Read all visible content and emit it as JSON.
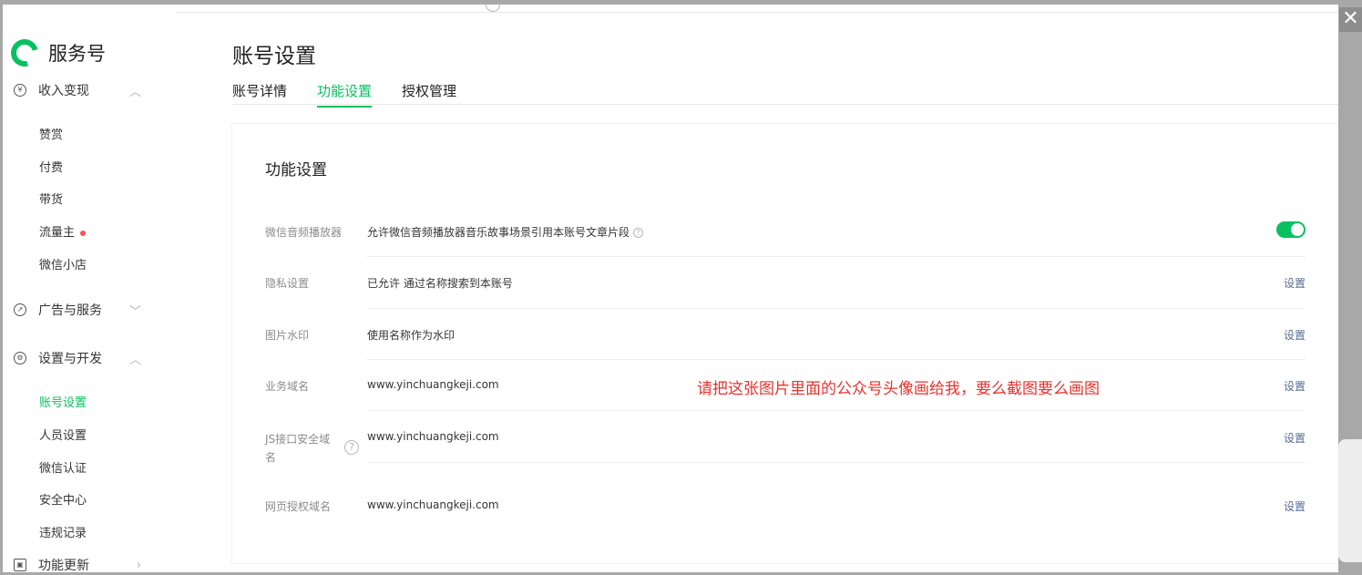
{
  "window": {
    "close_glyph": "✕"
  },
  "sidebar": {
    "brand": "服务号",
    "groups": [
      {
        "label": "收入变现",
        "icon": "yen-circle-icon",
        "chevron": "︿"
      },
      {
        "label": "广告与服务",
        "icon": "compass-icon",
        "chevron": "﹀"
      },
      {
        "label": "设置与开发",
        "icon": "gear-icon",
        "chevron": "︿"
      },
      {
        "label": "功能更新",
        "icon": "update-icon",
        "chevron": "›"
      }
    ],
    "income_items": [
      "赞赏",
      "付费",
      "带货",
      "流量主",
      "微信小店"
    ],
    "settings_items": [
      "账号设置",
      "人员设置",
      "微信认证",
      "安全中心",
      "违规记录"
    ]
  },
  "main": {
    "title": "账号设置",
    "tabs": [
      {
        "label": "账号详情",
        "active": false
      },
      {
        "label": "功能设置",
        "active": true
      },
      {
        "label": "授权管理",
        "active": false
      }
    ],
    "card_title": "功能设置",
    "rows": [
      {
        "label": "微信音频播放器",
        "value": "允许微信音频播放器音乐故事场景引用本账号文章片段",
        "toggle_on": true
      },
      {
        "label": "隐私设置",
        "value": "已允许 通过名称搜索到本账号",
        "action": "设置"
      },
      {
        "label": "图片水印",
        "value": "使用名称作为水印",
        "action": "设置"
      },
      {
        "label": "业务域名",
        "value": "www.yinchuangkeji.com",
        "action": "设置"
      },
      {
        "label": "JS接口安全域名",
        "label_line1": "JS接口安全域",
        "label_line2": "名",
        "value": "www.yinchuangkeji.com",
        "action": "设置"
      },
      {
        "label": "网页授权域名",
        "value": "www.yinchuangkeji.com",
        "action": "设置"
      }
    ],
    "overlay_note": "请把这张图片里面的公众号头像画给我，要么截图要么画图"
  },
  "colors": {
    "accent": "#07c160",
    "link": "#576b95",
    "alert": "#e8322e"
  }
}
